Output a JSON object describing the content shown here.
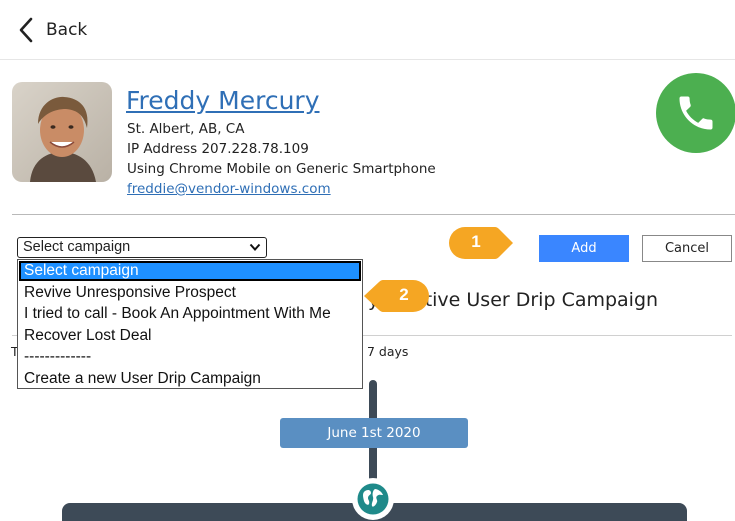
{
  "topbar": {
    "back_label": "Back"
  },
  "contact": {
    "name": "Freddy Mercury",
    "location": "St. Albert, AB, CA",
    "ip": "IP Address 207.228.78.109",
    "device": "Using Chrome Mobile on Generic Smartphone",
    "email": "freddie@vendor-windows.com"
  },
  "campaign_select": {
    "selected": "Select campaign",
    "options": [
      "Select campaign",
      "Revive Unresponsive Prospect",
      "I tried to call - Book An Appointment With Me",
      "Recover Lost Deal",
      "-------------",
      "Create a new User Drip Campaign"
    ]
  },
  "actions": {
    "add_label": "Add",
    "cancel_label": "Cancel"
  },
  "campaign": {
    "title_visible": "y inactive User Drip Campaign",
    "trigger_left": "T",
    "trigger_right": "7 days",
    "date": "June 1st 2020"
  },
  "markers": [
    "1",
    "2"
  ],
  "colors": {
    "link": "#2f6fb6",
    "call": "#4caf50",
    "add_button": "#3a86ff",
    "dropdown_highlight": "#1e90ff",
    "marker": "#f5a623",
    "date_pill": "#5a8fc2",
    "timeline": "#3d4a57"
  },
  "icons": [
    "chevron-left-icon",
    "phone-icon",
    "chevron-down-icon",
    "globe-icon"
  ]
}
